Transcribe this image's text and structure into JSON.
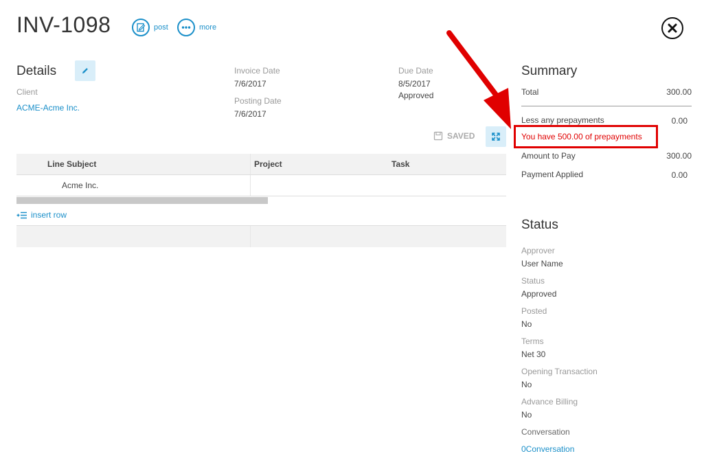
{
  "header": {
    "title": "INV-1098",
    "post_label": "post",
    "more_label": "more"
  },
  "details": {
    "heading": "Details",
    "client_label": "Client",
    "client_value": "ACME-Acme Inc.",
    "invoice_date_label": "Invoice Date",
    "invoice_date_value": "7/6/2017",
    "posting_date_label": "Posting Date",
    "posting_date_value": "7/6/2017",
    "due_date_label": "Due Date",
    "due_date_value": "8/5/2017",
    "approval_status": "Approved",
    "saved_label": "SAVED"
  },
  "table": {
    "columns": [
      "Line Subject",
      "Project",
      "Task"
    ],
    "rows": [
      {
        "line_subject": "Acme Inc.",
        "project": "",
        "task": ""
      }
    ],
    "insert_row_label": "insert row"
  },
  "summary": {
    "heading": "Summary",
    "total_label": "Total",
    "total_value": "300.00",
    "less_prepay_label": "Less any prepayments",
    "less_prepay_value": "0.00",
    "prepay_notice": "You have 500.00 of prepayments",
    "amount_to_pay_label": "Amount to Pay",
    "amount_to_pay_value": "300.00",
    "payment_applied_label": "Payment Applied",
    "payment_applied_value": "0.00"
  },
  "status": {
    "heading": "Status",
    "approver_label": "Approver",
    "approver_value": "User Name",
    "status_label": "Status",
    "status_value": "Approved",
    "posted_label": "Posted",
    "posted_value": "No",
    "terms_label": "Terms",
    "terms_value": "Net 30",
    "opening_label": "Opening Transaction",
    "opening_value": "No",
    "advance_label": "Advance Billing",
    "advance_value": "No",
    "conversation_label": "Conversation",
    "conversation_value": "0Conversation"
  },
  "colors": {
    "accent": "#1a8fc9",
    "highlight": "#e00000"
  }
}
